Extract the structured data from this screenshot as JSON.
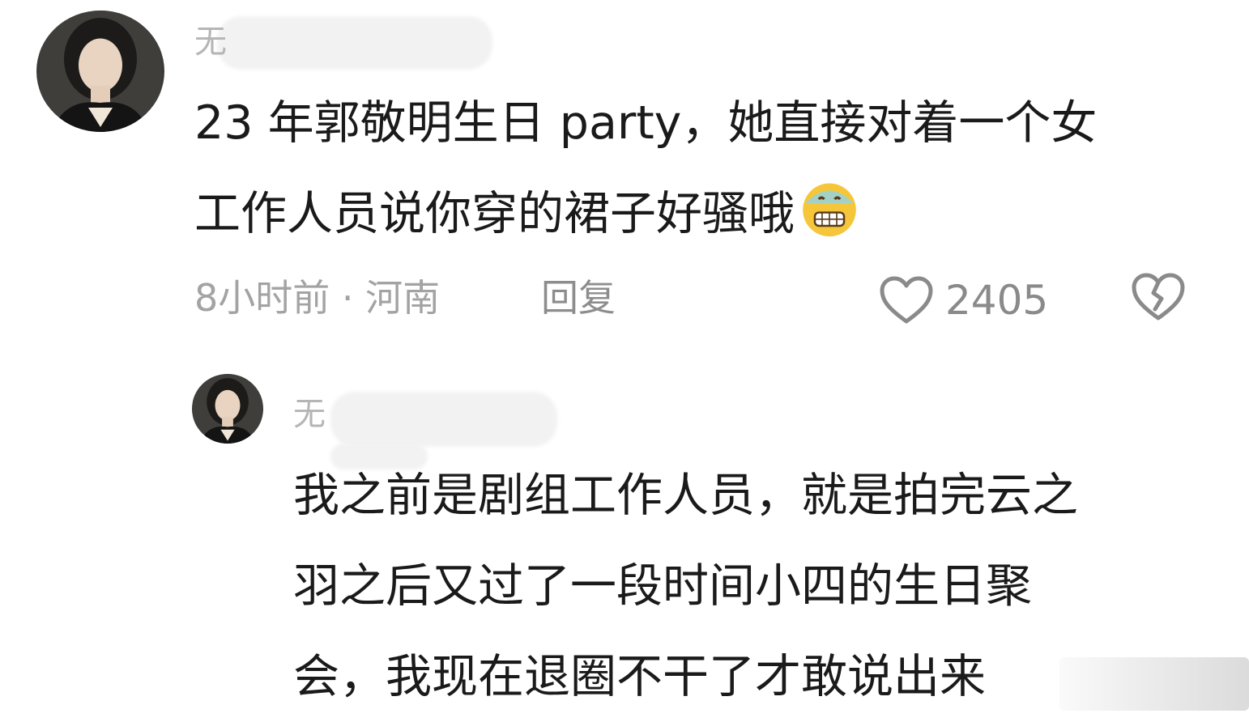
{
  "comment": {
    "username": "无",
    "text_line1": "23 年郭敬明生日 party，她直接对着一个女",
    "text_line2": "工作人员说你穿的裙子好骚哦",
    "time": "8小时前",
    "separator": "·",
    "location": "河南",
    "reply_label": "回复",
    "like_count": "2405",
    "emoji_icon": "cold-sweat-grimace-emoji"
  },
  "reply": {
    "username": "无",
    "text_line1": "我之前是剧组工作人员，就是拍完云之",
    "text_line2": "羽之后又过了一段时间小四的生日聚",
    "text_line3": "会，我现在退圈不干了才敢说出来"
  },
  "icons": {
    "like": "heart-outline-icon",
    "dislike": "broken-heart-icon"
  },
  "colors": {
    "text": "#1a1a1a",
    "meta": "#a3a3a3",
    "action": "#8a8a8a"
  }
}
